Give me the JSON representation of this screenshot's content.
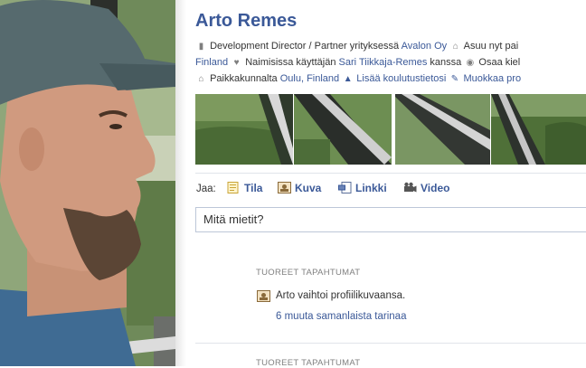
{
  "profile": {
    "name": "Arto Remes",
    "info_row1": {
      "job_prefix": "Development Director / Partner yrityksessä",
      "company": "Avalon Oy",
      "lives_prefix": "Asuu nyt pai",
      "work_icon": "briefcase-icon",
      "home_icon": "house-icon"
    },
    "info_row2": {
      "lives_place": "Finland",
      "married_prefix": "Naimisissa käyttäjän",
      "spouse": "Sari Tiikkaja-Remes",
      "married_suffix": "kanssa",
      "language_prefix": "Osaa kiel",
      "heart_icon": "heart-icon",
      "globe_icon": "globe-icon"
    },
    "info_row3": {
      "hometown_prefix": "Paikkakunnalta",
      "hometown": "Oulu, Finland",
      "add_education": "Lisää koulutustietosi",
      "edit_profile": "Muokkaa pro",
      "hometown_icon": "house-icon",
      "education_icon": "graduation-cap-icon",
      "edit_icon": "pencil-icon"
    }
  },
  "share": {
    "label": "Jaa:",
    "items": [
      {
        "label": "Tila",
        "icon": "status-icon"
      },
      {
        "label": "Kuva",
        "icon": "photo-icon"
      },
      {
        "label": "Linkki",
        "icon": "link-icon"
      },
      {
        "label": "Video",
        "icon": "video-camera-icon"
      }
    ],
    "placeholder": "Mitä mietit?"
  },
  "feed": {
    "sections": [
      {
        "title": "TUOREET TAPAHTUMAT",
        "story": "Arto vaihtoi profiilikuvaansa.",
        "more": "6 muuta samanlaista tarinaa",
        "icon": "photo-icon"
      },
      {
        "title": "TUOREET TAPAHTUMAT"
      }
    ]
  },
  "colors": {
    "link": "#3b5998",
    "text": "#333333",
    "muted": "#808080",
    "border": "#bdc7d8"
  }
}
